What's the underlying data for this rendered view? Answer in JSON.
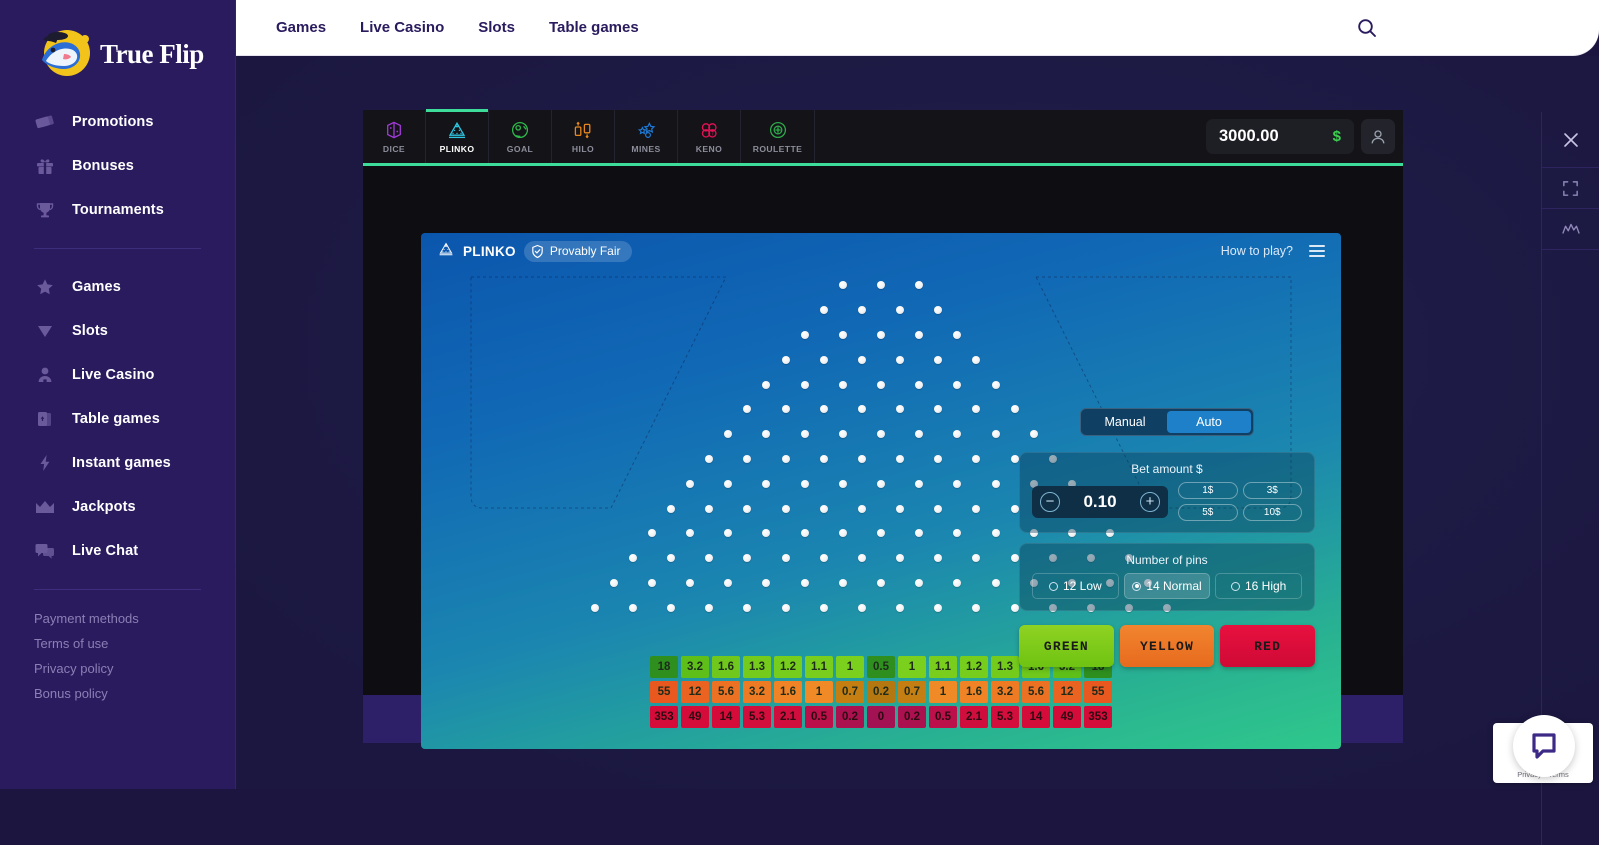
{
  "brand": {
    "name": "True Flip",
    "logo_icon": "truefilp-dolphin-logo"
  },
  "sidebar": {
    "primary": [
      {
        "label": "Promotions",
        "icon": "ticket-icon"
      },
      {
        "label": "Bonuses",
        "icon": "gift-icon"
      },
      {
        "label": "Tournaments",
        "icon": "trophy-icon"
      }
    ],
    "secondary": [
      {
        "label": "Games",
        "icon": "star-icon"
      },
      {
        "label": "Slots",
        "icon": "diamond-icon"
      },
      {
        "label": "Live Casino",
        "icon": "dealer-person-icon"
      },
      {
        "label": "Table games",
        "icon": "cards-icon"
      },
      {
        "label": "Instant games",
        "icon": "lightning-bolt-icon"
      },
      {
        "label": "Jackpots",
        "icon": "crown-icon"
      },
      {
        "label": "Live Chat",
        "icon": "chat-bubbles-icon"
      }
    ],
    "footer_links": [
      "Payment methods",
      "Terms of use",
      "Privacy policy",
      "Bonus policy"
    ]
  },
  "topbar": {
    "items": [
      "Games",
      "Live Casino",
      "Slots",
      "Table games"
    ],
    "search_icon": "search-icon"
  },
  "game_tabs": [
    {
      "label": "DICE",
      "icon": "dice-icon",
      "color": "#a23ad8",
      "active": false
    },
    {
      "label": "PLINKO",
      "icon": "plinko-icon",
      "color": "#2ec6e0",
      "active": true
    },
    {
      "label": "GOAL",
      "icon": "goal-ball-icon",
      "color": "#2fb84a",
      "active": false
    },
    {
      "label": "HILO",
      "icon": "hilo-arrows-icon",
      "color": "#e8871e",
      "active": false
    },
    {
      "label": "MINES",
      "icon": "mines-stars-icon",
      "color": "#1f7ad6",
      "active": false
    },
    {
      "label": "KENO",
      "icon": "keno-balls-icon",
      "color": "#e21254",
      "active": false
    },
    {
      "label": "ROULETTE",
      "icon": "roulette-wheel-icon",
      "color": "#2fa84a",
      "active": false
    }
  ],
  "account": {
    "balance": "3000.00",
    "currency": "$",
    "user_icon": "user-avatar-icon"
  },
  "board_header": {
    "game_icon": "plinko-icon",
    "title": "PLINKO",
    "provably_fair": "Provably Fair",
    "shield_icon": "shield-check-icon",
    "how_to_play": "How to play?",
    "menu_icon": "hamburger-menu-icon"
  },
  "controls": {
    "modes": [
      "Manual",
      "Auto"
    ],
    "active_mode": "Auto",
    "bet_label": "Bet amount $",
    "bet_value": "0.10",
    "decrement_icon": "minus-circle-icon",
    "increment_icon": "plus-circle-icon",
    "quick_amounts": [
      "1$",
      "3$",
      "5$",
      "10$"
    ],
    "pins_label": "Number of pins",
    "pin_options": [
      {
        "label": "12 Low",
        "selected": false
      },
      {
        "label": "14 Normal",
        "selected": true
      },
      {
        "label": "16 High",
        "selected": false
      }
    ],
    "risk_buttons": [
      {
        "label": "GREEN",
        "color": "#7fca1b"
      },
      {
        "label": "YELLOW",
        "color": "#ec7622"
      },
      {
        "label": "RED",
        "color": "#db0c3a"
      }
    ]
  },
  "rail": [
    {
      "icon": "close-icon"
    },
    {
      "icon": "fullscreen-icon"
    },
    {
      "icon": "statistics-chart-icon"
    }
  ],
  "chat_widget": {
    "icon": "chat-bubble-icon",
    "recaptcha_text": "Privacy - Terms"
  },
  "plinko": {
    "rows": 14,
    "first_row_pins": 3,
    "multipliers": {
      "green": [
        "18",
        "3.2",
        "1.6",
        "1.3",
        "1.2",
        "1.1",
        "1",
        "0.5",
        "1",
        "1.1",
        "1.2",
        "1.3",
        "1.6",
        "3.2",
        "18"
      ],
      "yellow": [
        "55",
        "12",
        "5.6",
        "3.2",
        "1.6",
        "1",
        "0.7",
        "0.2",
        "0.7",
        "1",
        "1.6",
        "3.2",
        "5.6",
        "12",
        "55"
      ],
      "red": [
        "353",
        "49",
        "14",
        "5.3",
        "2.1",
        "0.5",
        "0.2",
        "0",
        "0.2",
        "0.5",
        "2.1",
        "5.3",
        "14",
        "49",
        "353"
      ]
    }
  },
  "colors": {
    "sidebar_bg": "#2a1b5e",
    "accent_green": "#3ddc9a",
    "board_top": "#0b56ad",
    "board_bottom": "#2fc88c"
  }
}
